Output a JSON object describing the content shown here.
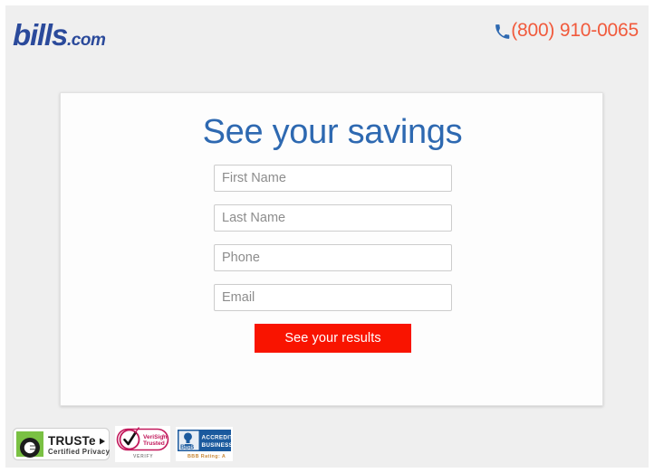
{
  "header": {
    "logo": {
      "brand": "bills",
      "tld": ".com",
      "color": "#2b4a9b"
    },
    "phone": {
      "icon": "phone-icon",
      "number": "(800) 910-0065",
      "color": "#f15a3c",
      "icon_color": "#2e69b1"
    }
  },
  "card": {
    "title": "See your savings",
    "title_color": "#2e69b1",
    "form": {
      "fields": [
        {
          "name": "first-name",
          "placeholder": "First Name",
          "value": ""
        },
        {
          "name": "last-name",
          "placeholder": "Last Name",
          "value": ""
        },
        {
          "name": "phone",
          "placeholder": "Phone",
          "value": ""
        },
        {
          "name": "email",
          "placeholder": "Email",
          "value": ""
        }
      ],
      "submit_label": "See your results",
      "submit_color": "#f91400"
    }
  },
  "badges": [
    {
      "name": "truste-badge",
      "title": "TRUSTe",
      "subtitle": "Certified Privacy",
      "color": "#7ac143"
    },
    {
      "name": "verisign-badge",
      "line1": "VeriSign",
      "line2": "Trusted",
      "line3": "VERIFY",
      "color": "#c2185b"
    },
    {
      "name": "bbb-badge",
      "line1": "ACCREDITED",
      "line2": "BUSINESS",
      "line3": "BBB Rating: A",
      "abbr": "BBB",
      "color": "#1b5a9e"
    }
  ],
  "page": {
    "background": "#efefef"
  }
}
